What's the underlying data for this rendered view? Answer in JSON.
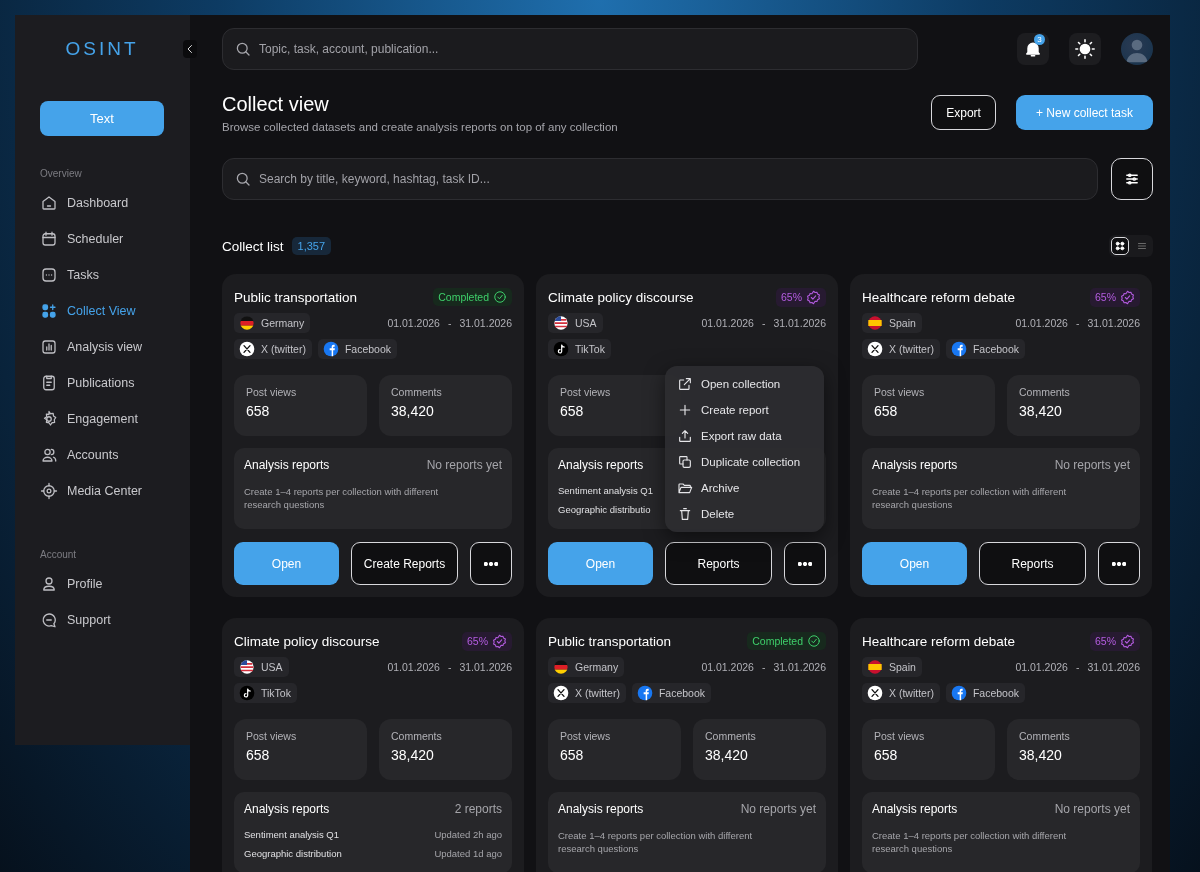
{
  "sidebar": {
    "logo": "OSINT",
    "primary_button": "Text",
    "sections": [
      {
        "title": "Overview",
        "items": [
          {
            "label": "Dashboard",
            "selected": false
          },
          {
            "label": "Scheduler",
            "selected": false
          },
          {
            "label": "Tasks",
            "selected": false
          },
          {
            "label": "Collect View",
            "selected": true
          },
          {
            "label": "Analysis view",
            "selected": false
          },
          {
            "label": "Publications",
            "selected": false
          },
          {
            "label": "Engagement",
            "selected": false
          },
          {
            "label": "Accounts",
            "selected": false
          },
          {
            "label": "Media Center",
            "selected": false
          }
        ]
      },
      {
        "title": "Account",
        "items": [
          {
            "label": "Profile",
            "selected": false
          },
          {
            "label": "Support",
            "selected": false
          }
        ]
      }
    ]
  },
  "header": {
    "search": {
      "placeholder": "Topic, task, account, publication..."
    },
    "notifications": {
      "count": "3"
    }
  },
  "page": {
    "title": "Collect view",
    "subtitle": "Browse collected datasets and create analysis reports on top of any collection",
    "buttons": [
      {
        "kind": "secondary",
        "label": "Export"
      },
      {
        "kind": "primary",
        "label": "+ New collect task"
      }
    ]
  },
  "filter_search": {
    "placeholder": "Search by title, keyword, hashtag, task ID..."
  },
  "collect_list": {
    "title": "Collect list",
    "count": "1,357",
    "views": [
      {
        "kind": "grid",
        "selected": true
      },
      {
        "kind": "list",
        "selected": false
      }
    ]
  },
  "cards": [
    {
      "title": "Public transportation",
      "status": {
        "kind": "completed",
        "label": "Completed"
      },
      "country": {
        "kind": "de",
        "label": "Germany"
      },
      "dates": {
        "start": "01.01.2026",
        "separator": "-",
        "end": "31.01.2026"
      },
      "platforms": [
        {
          "kind": "x",
          "label": "X (twitter)"
        },
        {
          "kind": "facebook",
          "label": "Facebook"
        }
      ],
      "stats": [
        {
          "label": "Post views",
          "value": "658"
        },
        {
          "label": "Comments",
          "value": "38,420"
        }
      ],
      "reports": {
        "title": "Analysis reports",
        "summary": "No reports yet",
        "note": "Create 1–4 reports per collection with different research questions"
      },
      "actions": {
        "open": "Open",
        "reports": "Create Reports"
      }
    },
    {
      "title": "Climate policy discourse",
      "status": {
        "kind": "progress",
        "label": "65%"
      },
      "country": {
        "kind": "us",
        "label": "USA"
      },
      "dates": {
        "start": "01.01.2026",
        "separator": "-",
        "end": "31.01.2026"
      },
      "platforms": [
        {
          "kind": "tiktok",
          "label": "TikTok"
        }
      ],
      "stats": [
        {
          "label": "Post views",
          "value": "658"
        }
      ],
      "reports": {
        "title": "Analysis reports",
        "items": [
          {
            "name": "Sentiment analysis Q1"
          },
          {
            "name": "Geographic distributio"
          }
        ]
      },
      "actions": {
        "open": "Open",
        "reports": "Reports"
      },
      "menu": {
        "items": [
          {
            "kind": "open",
            "label": "Open collection"
          },
          {
            "kind": "create",
            "label": "Create report"
          },
          {
            "kind": "export",
            "label": "Export raw data"
          },
          {
            "kind": "duplicate",
            "label": "Duplicate collection"
          },
          {
            "kind": "archive",
            "label": "Archive"
          },
          {
            "kind": "delete",
            "label": "Delete"
          }
        ]
      }
    },
    {
      "title": "Healthcare reform debate",
      "status": {
        "kind": "progress",
        "label": "65%"
      },
      "country": {
        "kind": "es",
        "label": "Spain"
      },
      "dates": {
        "start": "01.01.2026",
        "separator": "-",
        "end": "31.01.2026"
      },
      "platforms": [
        {
          "kind": "x",
          "label": "X (twitter)"
        },
        {
          "kind": "facebook",
          "label": "Facebook"
        }
      ],
      "stats": [
        {
          "label": "Post views",
          "value": "658"
        },
        {
          "label": "Comments",
          "value": "38,420"
        }
      ],
      "reports": {
        "title": "Analysis reports",
        "summary": "No reports yet",
        "note": "Create 1–4 reports per collection with different research questions"
      },
      "actions": {
        "open": "Open",
        "reports": "Reports"
      }
    },
    {
      "title": "Climate policy discourse",
      "status": {
        "kind": "progress",
        "label": "65%"
      },
      "country": {
        "kind": "us",
        "label": "USA"
      },
      "dates": {
        "start": "01.01.2026",
        "separator": "-",
        "end": "31.01.2026"
      },
      "platforms": [
        {
          "kind": "tiktok",
          "label": "TikTok"
        }
      ],
      "stats": [
        {
          "label": "Post views",
          "value": "658"
        },
        {
          "label": "Comments",
          "value": "38,420"
        }
      ],
      "reports": {
        "title": "Analysis reports",
        "summary": "2 reports",
        "items": [
          {
            "name": "Sentiment analysis Q1",
            "updated": "Updated 2h ago"
          },
          {
            "name": "Geographic distribution",
            "updated": "Updated 1d ago"
          }
        ]
      }
    },
    {
      "title": "Public transportation",
      "status": {
        "kind": "completed",
        "label": "Completed"
      },
      "country": {
        "kind": "de",
        "label": "Germany"
      },
      "dates": {
        "start": "01.01.2026",
        "separator": "-",
        "end": "31.01.2026"
      },
      "platforms": [
        {
          "kind": "x",
          "label": "X (twitter)"
        },
        {
          "kind": "facebook",
          "label": "Facebook"
        }
      ],
      "stats": [
        {
          "label": "Post views",
          "value": "658"
        },
        {
          "label": "Comments",
          "value": "38,420"
        }
      ],
      "reports": {
        "title": "Analysis reports",
        "summary": "No reports yet",
        "note": "Create 1–4 reports per collection with different research questions"
      }
    },
    {
      "title": "Healthcare reform debate",
      "status": {
        "kind": "progress",
        "label": "65%"
      },
      "country": {
        "kind": "es",
        "label": "Spain"
      },
      "dates": {
        "start": "01.01.2026",
        "separator": "-",
        "end": "31.01.2026"
      },
      "platforms": [
        {
          "kind": "x",
          "label": "X (twitter)"
        },
        {
          "kind": "facebook",
          "label": "Facebook"
        }
      ],
      "stats": [
        {
          "label": "Post views",
          "value": "658"
        },
        {
          "label": "Comments",
          "value": "38,420"
        }
      ],
      "reports": {
        "title": "Analysis reports",
        "summary": "No reports yet",
        "note": "Create 1–4 reports per collection with different research questions"
      }
    }
  ]
}
